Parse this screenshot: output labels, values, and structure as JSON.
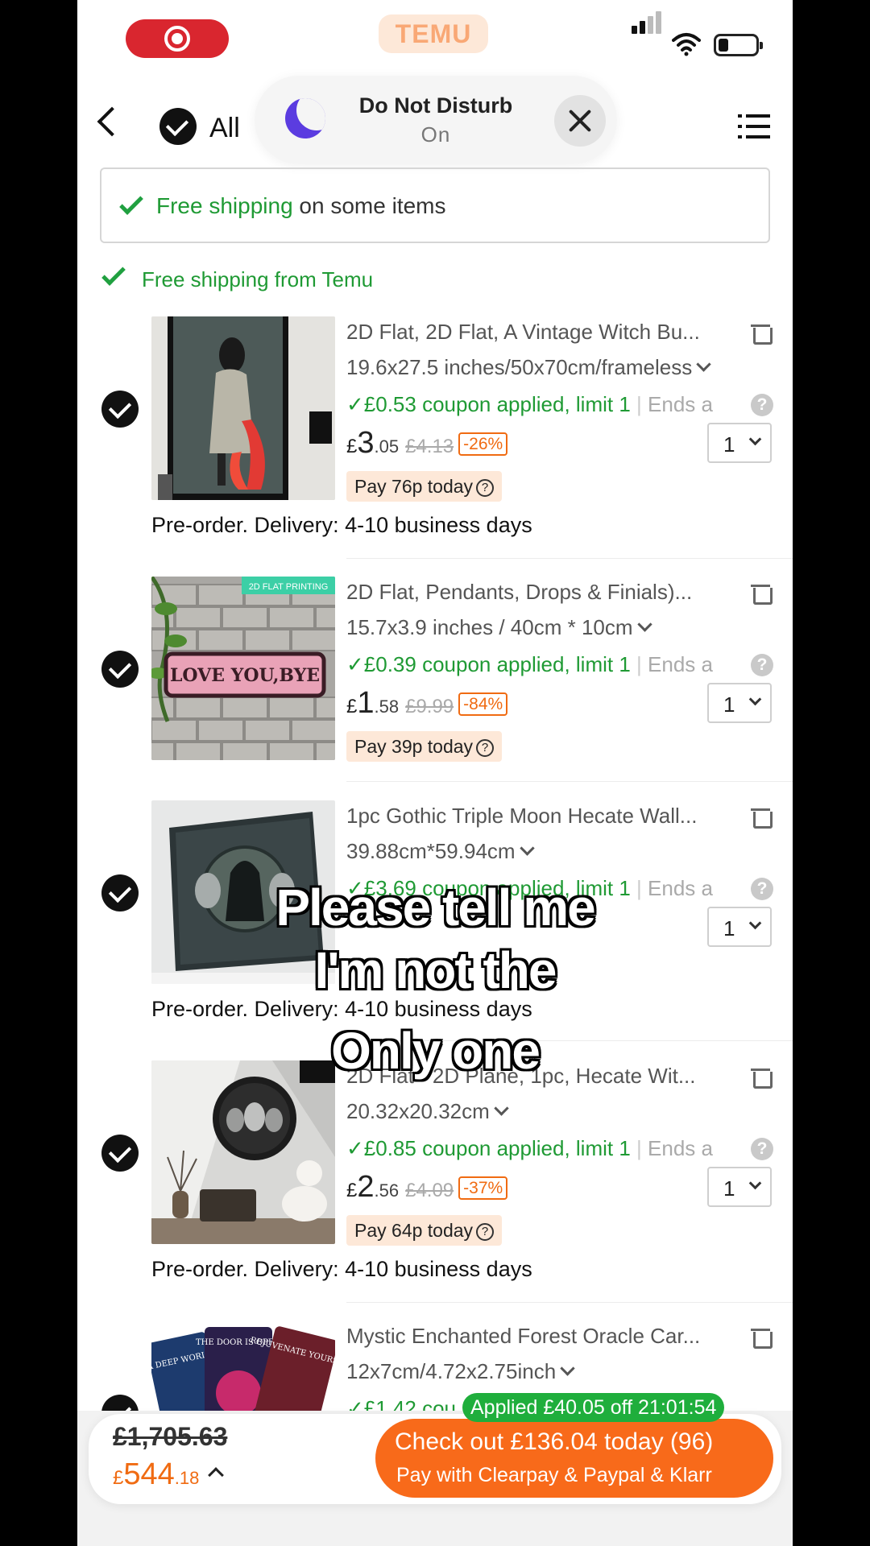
{
  "status_bar": {
    "brand": "TEMU"
  },
  "dnd": {
    "title": "Do Not Disturb",
    "status": "On"
  },
  "header": {
    "select_all_label": "All"
  },
  "shipping_banner": {
    "highlight": "Free shipping",
    "rest": " on some items"
  },
  "shipping_group": {
    "label": "Free shipping from Temu"
  },
  "items": [
    {
      "title": "2D Flat, 2D Flat, A Vintage Witch Bu...",
      "spec": "19.6x27.5 inches/50x70cm/frameless",
      "coupon": "✓£0.53 coupon applied, limit 1",
      "ends": "Ends a",
      "price_currency": "£",
      "price_int": "3",
      "price_dec": ".05",
      "old_price": "£4.13",
      "discount": "-26%",
      "qty": "1",
      "pay_today": "Pay 76p today",
      "preorder": "Pre-order. Delivery: 4-10 business days"
    },
    {
      "title": "2D Flat, Pendants, Drops & Finials)...",
      "spec": "15.7x3.9 inches / 40cm * 10cm",
      "coupon": "✓£0.39 coupon applied, limit 1",
      "ends": "Ends a",
      "price_currency": "£",
      "price_int": "1",
      "price_dec": ".58",
      "old_price": "£9.99",
      "discount": "-84%",
      "qty": "1",
      "pay_today": "Pay 39p today",
      "thumb_tag": "2D FLAT PRINTING",
      "thumb_text": "LOVE YOU,BYE"
    },
    {
      "title": "1pc Gothic Triple Moon Hecate Wall...",
      "spec": "39.88cm*59.94cm",
      "coupon": "✓£3.69 coupon applied, limit 1",
      "ends": "Ends a",
      "qty": "1",
      "preorder": "Pre-order. Delivery: 4-10 business days"
    },
    {
      "title": "2D Flat - 2D Plane, 1pc, Hecate Wit...",
      "spec": "20.32x20.32cm",
      "coupon": "✓£0.85 coupon applied, limit 1",
      "ends": "Ends a",
      "price_currency": "£",
      "price_int": "2",
      "price_dec": ".56",
      "old_price": "£4.09",
      "discount": "-37%",
      "qty": "1",
      "pay_today": "Pay 64p today",
      "preorder": "Pre-order. Delivery: 4-10 business days"
    },
    {
      "title": "Mystic Enchanted Forest Oracle Car...",
      "spec": "12x7cm/4.72x2.75inch",
      "coupon": "✓£1.42 cou",
      "thumb_cards": [
        "THE DOOR IS OPEN",
        "REJUVENATE YOURSELF",
        "A DEEP WORLD"
      ]
    }
  ],
  "overlay_text": [
    "Please tell me",
    "I'm not the",
    "Only one"
  ],
  "footer": {
    "old_total": "£1,705.63",
    "total_currency": "£",
    "total_int": "544",
    "total_dec": ".18",
    "applied": "Applied £40.05 off 21:01:54",
    "checkout_line1": "Check out £136.04 today (96)",
    "checkout_line2": "Pay with Clearpay & Paypal & Klarr"
  },
  "colors": {
    "accent": "#f86a1a",
    "success": "#1f9a34",
    "record": "#d9262f",
    "dnd_moon": "#5b3ce0"
  }
}
